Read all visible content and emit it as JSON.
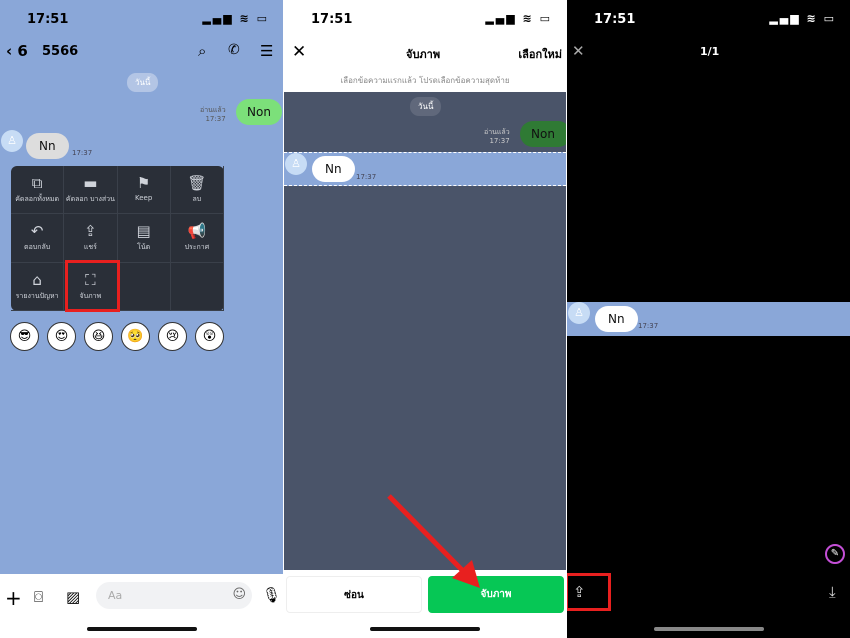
{
  "status": {
    "time": "17:51",
    "icons": "▂▄▆ ≋ ▭"
  },
  "panel1": {
    "back_label": "6",
    "chat_name": "5566",
    "date_label": "วันนี้",
    "sent": {
      "text": "Non",
      "read": "อ่านแล้ว",
      "time": "17:37"
    },
    "recv": {
      "text": "Nn",
      "time": "17:37"
    },
    "menu": [
      {
        "icon": "⧉",
        "label": "คัดลอกทั้งหมด",
        "name": "copy-all"
      },
      {
        "icon": "▬",
        "label": "คัดลอก บางส่วน",
        "name": "copy-partial"
      },
      {
        "icon": "⚑",
        "label": "Keep",
        "name": "keep"
      },
      {
        "icon": "🗑",
        "label": "ลบ",
        "name": "delete"
      },
      {
        "icon": "↶",
        "label": "ตอบกลับ",
        "name": "reply"
      },
      {
        "icon": "⇪",
        "label": "แชร์",
        "name": "share"
      },
      {
        "icon": "▤",
        "label": "โน้ต",
        "name": "note"
      },
      {
        "icon": "📢",
        "label": "ประกาศ",
        "name": "announce"
      },
      {
        "icon": "⌂",
        "label": "รายงานปัญหา",
        "name": "report"
      },
      {
        "icon": "⛶",
        "label": "จับภาพ",
        "name": "screenshot"
      }
    ],
    "emojis": [
      "😎",
      "😍",
      "😆",
      "🥺",
      "😢",
      "😲"
    ],
    "input_placeholder": "Aa"
  },
  "panel2": {
    "title": "จับภาพ",
    "reselect": "เลือกใหม่",
    "hint": "เลือกข้อความแรกแล้ว โปรดเลือกข้อความสุดท้าย",
    "date_label": "วันนี้",
    "sent": {
      "text": "Non",
      "read": "อ่านแล้ว",
      "time": "17:37"
    },
    "recv": {
      "text": "Nn",
      "time": "17:37"
    },
    "hide_label": "ซ่อน",
    "capture_label": "จับภาพ"
  },
  "panel3": {
    "counter": "1/1",
    "recv": {
      "text": "Nn",
      "time": "17:37"
    }
  },
  "colors": {
    "accent_green": "#06c755",
    "highlight_red": "#e8201f",
    "chat_bg": "#8aa7d8"
  }
}
